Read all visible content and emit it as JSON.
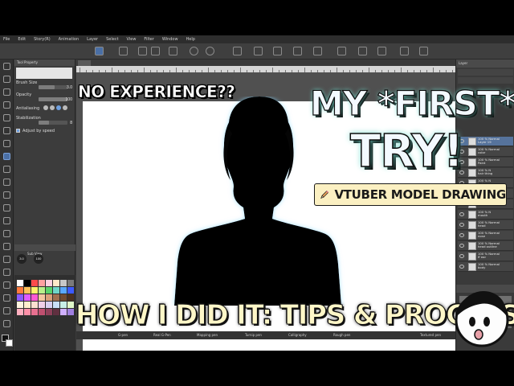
{
  "menubar": {
    "items": [
      "File",
      "Edit",
      "Story(R)",
      "Animation",
      "Layer",
      "Select",
      "View",
      "Filter",
      "Window",
      "Help"
    ]
  },
  "subtool_panel": {
    "header": "Tool Property",
    "brush_size_label": "Brush Size",
    "brush_size_value": "3.0",
    "opacity_label": "Opacity",
    "opacity_value": "100",
    "antialiasing_label": "Antialiasing",
    "stabilization_label": "Stabilization",
    "stabilization_value": "8",
    "adjust_by_speed_label": "Adjust by speed",
    "brush_size_level": 0.55,
    "opacity_level": 1.0,
    "stabilization_level": 0.35
  },
  "sub_view": {
    "header": "Sub View",
    "brush_value": "3.0",
    "opacity_value": "100"
  },
  "canvas_tab": {
    "label": "Untitl"
  },
  "layers": {
    "header": "Layer",
    "rows": [
      {
        "line1": "100 % Normal",
        "line2": "Layer 19"
      },
      {
        "line1": "100 % Normal",
        "line2": "color"
      },
      {
        "line1": "100 % Normal",
        "line2": "Paint"
      },
      {
        "line1": "100 % N",
        "line2": "hair thing"
      },
      {
        "line1": "100 % N",
        "line2": "hair"
      },
      {
        "line1": "100 % N",
        "line2": "eye"
      },
      {
        "line1": "100 % Normal",
        "line2": "blush"
      },
      {
        "line1": "100 % N",
        "line2": "mouth"
      },
      {
        "line1": "100 % Normal",
        "line2": "head"
      },
      {
        "line1": "100 % Normal",
        "line2": "nose"
      },
      {
        "line1": "100 % Normal",
        "line2": "head outline"
      },
      {
        "line1": "100 % Normal",
        "line2": "ff ear"
      },
      {
        "line1": "100 % Normal",
        "line2": "body"
      }
    ],
    "selected_index": 0
  },
  "brushes": {
    "names": [
      "G-pen",
      "Real G-Pen",
      "Mapping pen",
      "Turnip pen",
      "Calligraphy",
      "Rough pen",
      "Textured pen"
    ]
  },
  "overlay": {
    "no_experience": "NO EXPERIENCE??",
    "my_first": "MY *FIRST*",
    "try": "TRY!",
    "badge": "VTUBER MODEL DRAWING",
    "bottom": "HOW I DID IT: TIPS & PROCESS"
  },
  "colors": {
    "title_glow": "#6fd6c9",
    "badge_bg": "#fbf0c2",
    "bottom_text": "#fff7c8",
    "selected_layer": "#56739c"
  },
  "icons": [
    "pencil-icon",
    "eye-icon",
    "folder-icon"
  ]
}
